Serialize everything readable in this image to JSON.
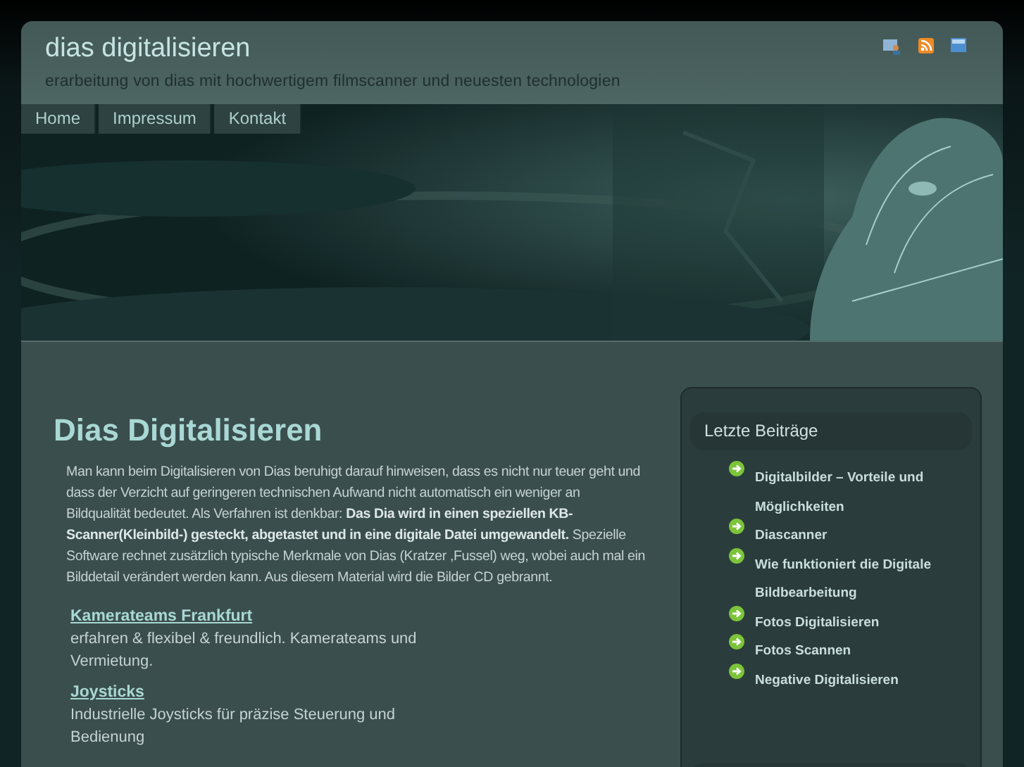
{
  "header": {
    "title": "dias digitalisieren",
    "tagline": "erarbeitung von dias mit hochwertigem filmscanner und neuesten technologien"
  },
  "nav": [
    {
      "label": "Home"
    },
    {
      "label": "Impressum"
    },
    {
      "label": "Kontakt"
    }
  ],
  "article": {
    "title": "Dias Digitalisieren",
    "body": "Man kann beim Digitalisieren von Dias beruhigt darauf hinweisen, dass es nicht nur teuer geht und dass der Verzicht auf geringeren technischen Aufwand nicht automatisch ein weniger an Bildqualität bedeutet. Als Verfahren ist denkbar: **Das Dia wird in einen speziellen KB-Scanner(Kleinbild-) gesteckt, abgetastet und in eine digitale Datei umgewandelt.** Spezielle Software rechnet zusätzlich typische Merkmale von Dias (Kratzer ,Fussel) weg, wobei auch mal ein Bilddetail verändert werden kann. Aus diesem Material wird die Bilder CD gebrannt."
  },
  "ads": [
    {
      "title": "Kamerateams Frankfurt",
      "text": "erfahren & flexibel & freundlich. Kamerateams und Vermietung."
    },
    {
      "title": "Joysticks",
      "text": "Industrielle Joysticks für präzise Steuerung und Bedienung"
    }
  ],
  "sidebar": {
    "heading": "Letzte Beiträge",
    "items": [
      "Digitalbilder – Vorteile und Möglichkeiten",
      "Diascanner",
      "Wie funktioniert die Digitale Bildbearbeitung",
      "Fotos Digitalisieren",
      "Fotos Scannen",
      "Negative Digitalisieren"
    ]
  }
}
